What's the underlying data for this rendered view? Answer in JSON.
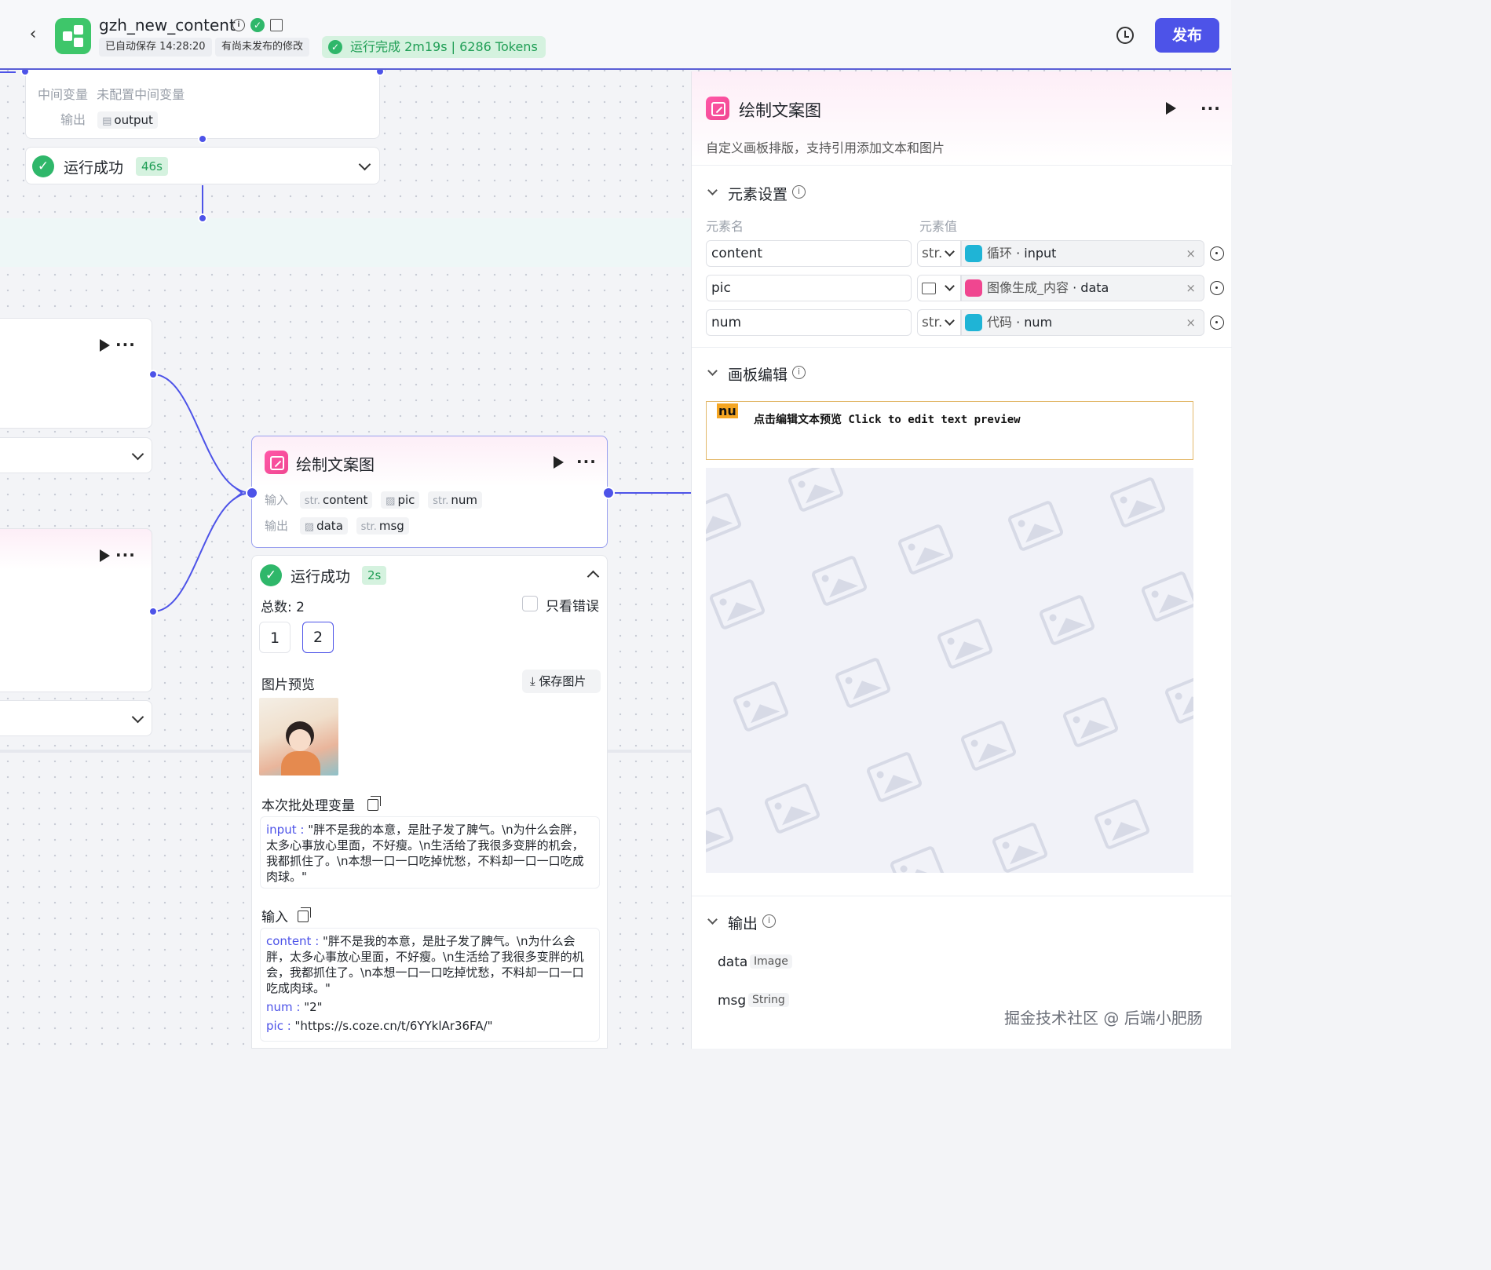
{
  "header": {
    "app_name": "gzh_new_content",
    "autosave": "已自动保存 14:28:20",
    "unpublished": "有尚未发布的修改",
    "run_status": "运行完成 2m19s | 6286 Tokens",
    "publish_label": "发布"
  },
  "top_node": {
    "intermediate_label": "中间变量",
    "intermediate_value": "未配置中间变量",
    "output_label": "输出",
    "output_param": "output",
    "run_status": "运行成功",
    "run_duration": "46s"
  },
  "main_node": {
    "title": "绘制文案图",
    "input_label": "输入",
    "output_label": "输出",
    "inputs": [
      {
        "type": "str.",
        "name": "content"
      },
      {
        "type": "image",
        "name": "pic"
      },
      {
        "type": "str.",
        "name": "num"
      }
    ],
    "outputs": [
      {
        "type": "image",
        "name": "data"
      },
      {
        "type": "str.",
        "name": "msg"
      }
    ],
    "result": {
      "status": "运行成功",
      "duration": "2s",
      "total": "总数: 2",
      "only_errors": "只看错误",
      "pages": [
        "1",
        "2"
      ],
      "selected_page": "2",
      "preview_label": "图片预览",
      "save_image": "保存图片",
      "batch_vars_label": "本次批处理变量",
      "batch_key": "input",
      "batch_value": "\"胖不是我的本意，是肚子发了脾气。\\n为什么会胖，太多心事放心里面，不好瘦。\\n生活给了我很多变胖的机会，我都抓住了。\\n本想一口一口吃掉忧愁，不料却一口一口吃成肉球。\"",
      "input_label": "输入",
      "inputs": [
        {
          "key": "content",
          "value": "\"胖不是我的本意，是肚子发了脾气。\\n为什么会胖，太多心事放心里面，不好瘦。\\n生活给了我很多变胖的机会，我都抓住了。\\n本想一口一口吃掉忧愁，不料却一口一口吃成肉球。\""
        },
        {
          "key": "num",
          "value": "\"2\""
        },
        {
          "key": "pic",
          "value": "\"https://s.coze.cn/t/6YYklAr36FA/\""
        }
      ]
    }
  },
  "panel": {
    "title": "绘制文案图",
    "description": "自定义画板排版，支持引用添加文本和图片",
    "elements_section": "元素设置",
    "col_name": "元素名",
    "col_value": "元素值",
    "elements": [
      {
        "name": "content",
        "type": "str.",
        "source": "循环",
        "field": "input",
        "source_color": "#1fb4d6"
      },
      {
        "name": "pic",
        "type": "image",
        "source": "图像生成_内容",
        "field": "data",
        "source_color": "#f04690"
      },
      {
        "name": "num",
        "type": "str.",
        "source": "代码",
        "field": "num",
        "source_color": "#1fb4d6"
      }
    ],
    "canvas_section": "画板编辑",
    "canvas_tag": "nu",
    "canvas_hint": "点击编辑文本预览 Click to edit text preview",
    "output_section": "输出",
    "outputs": [
      {
        "name": "data",
        "type": "Image"
      },
      {
        "name": "msg",
        "type": "String"
      }
    ]
  },
  "watermark": "掘金技术社区 @ 后端小肥肠"
}
